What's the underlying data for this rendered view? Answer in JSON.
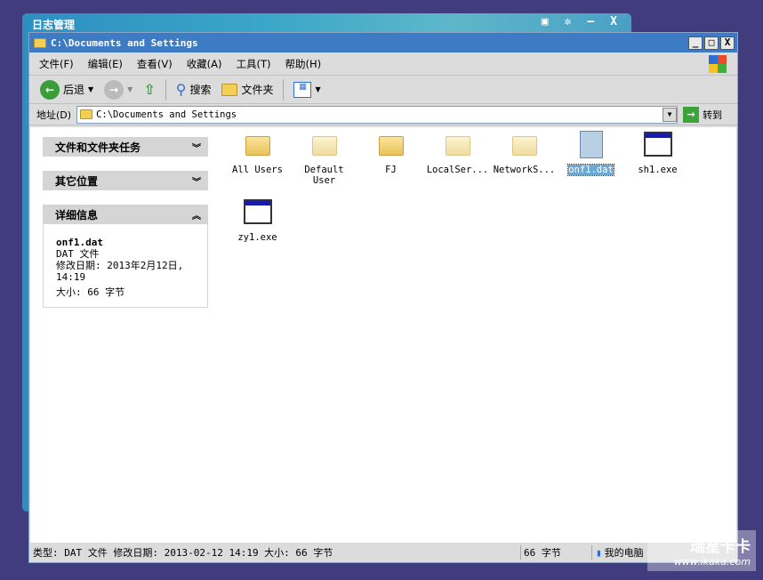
{
  "back_window": {
    "title": "日志管理",
    "controls": [
      "▣",
      "✲",
      "–",
      "X"
    ]
  },
  "window": {
    "title": "C:\\Documents and Settings"
  },
  "menu": [
    "文件(F)",
    "编辑(E)",
    "查看(V)",
    "收藏(A)",
    "工具(T)",
    "帮助(H)"
  ],
  "toolbar": {
    "back": "后退",
    "search": "搜索",
    "folders": "文件夹"
  },
  "address": {
    "label": "地址(D)",
    "value": "C:\\Documents and Settings",
    "go": "转到"
  },
  "sidebar": {
    "tasks": "文件和文件夹任务",
    "other": "其它位置",
    "details": {
      "title": "详细信息",
      "name": "onf1.dat",
      "type": "DAT 文件",
      "modified": "修改日期: 2013年2月12日, 14:19",
      "size": "大小: 66 字节"
    }
  },
  "files": [
    {
      "name": "All Users",
      "kind": "folder"
    },
    {
      "name": "Default User",
      "kind": "folder-pale"
    },
    {
      "name": "FJ",
      "kind": "folder"
    },
    {
      "name": "LocalSer...",
      "kind": "folder-pale"
    },
    {
      "name": "NetworkS...",
      "kind": "folder-pale"
    },
    {
      "name": "onf1.dat",
      "kind": "dat",
      "selected": true
    },
    {
      "name": "sh1.exe",
      "kind": "exe"
    },
    {
      "name": "zy1.exe",
      "kind": "exe"
    }
  ],
  "status": {
    "info": "类型: DAT 文件 修改日期: 2013-02-12 14:19 大小: 66 字节",
    "size": "66 字节",
    "zone": "我的电脑"
  },
  "watermark": {
    "brand": "瑞星卡卡",
    "url": "www.ikaka.com"
  }
}
